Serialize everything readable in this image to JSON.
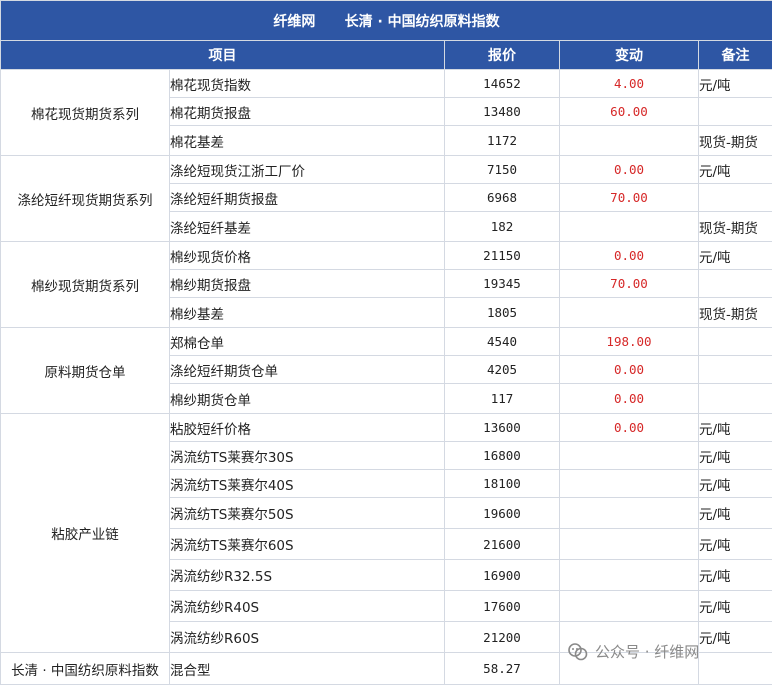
{
  "title": {
    "source": "纤维网",
    "index_name": "长清 · 中国纺织原料指数"
  },
  "columns": {
    "item": "项目",
    "price": "报价",
    "change": "变动",
    "note": "备注"
  },
  "groups": [
    {
      "name": "棉花现货期货系列",
      "rows": [
        {
          "item": "棉花现货指数",
          "price": "14652",
          "change": "4.00",
          "note": "元/吨"
        },
        {
          "item": "棉花期货报盘",
          "price": "13480",
          "change": "60.00",
          "note": ""
        },
        {
          "item": "棉花基差",
          "price": "1172",
          "change": "",
          "note": "现货-期货"
        }
      ]
    },
    {
      "name": "涤纶短纤现货期货系列",
      "rows": [
        {
          "item": "涤纶短现货江浙工厂价",
          "price": "7150",
          "change": "0.00",
          "note": "元/吨"
        },
        {
          "item": "涤纶短纤期货报盘",
          "price": "6968",
          "change": "70.00",
          "note": ""
        },
        {
          "item": "涤纶短纤基差",
          "price": "182",
          "change": "",
          "note": "现货-期货"
        }
      ]
    },
    {
      "name": "棉纱现货期货系列",
      "rows": [
        {
          "item": "棉纱现货价格",
          "price": "21150",
          "change": "0.00",
          "note": "元/吨"
        },
        {
          "item": "棉纱期货报盘",
          "price": "19345",
          "change": "70.00",
          "note": ""
        },
        {
          "item": "棉纱基差",
          "price": "1805",
          "change": "",
          "note": "现货-期货"
        }
      ]
    },
    {
      "name": "原料期货仓单",
      "rows": [
        {
          "item": "郑棉仓单",
          "price": "4540",
          "change": "198.00",
          "note": ""
        },
        {
          "item": "涤纶短纤期货仓单",
          "price": "4205",
          "change": "0.00",
          "note": ""
        },
        {
          "item": "棉纱期货仓单",
          "price": "117",
          "change": "0.00",
          "note": ""
        }
      ]
    },
    {
      "name": "粘胶产业链",
      "rows": [
        {
          "item": "粘胶短纤价格",
          "price": "13600",
          "change": "0.00",
          "note": "元/吨"
        },
        {
          "item": "涡流纺TS莱赛尔30S",
          "price": "16800",
          "change": "",
          "note": "元/吨"
        },
        {
          "item": "涡流纺TS莱赛尔40S",
          "price": "18100",
          "change": "",
          "note": "元/吨"
        },
        {
          "item": "涡流纺TS莱赛尔50S",
          "price": "19600",
          "change": "",
          "note": "元/吨"
        },
        {
          "item": "涡流纺TS莱赛尔60S",
          "price": "21600",
          "change": "",
          "note": "元/吨"
        },
        {
          "item": "涡流纺纱R32.5S",
          "price": "16900",
          "change": "",
          "note": "元/吨"
        },
        {
          "item": "涡流纺纱R40S",
          "price": "17600",
          "change": "",
          "note": "元/吨"
        },
        {
          "item": "涡流纺纱R60S",
          "price": "21200",
          "change": "",
          "note": "元/吨"
        }
      ]
    }
  ],
  "summary": {
    "label": "长清 · 中国纺织原料指数",
    "type": "混合型",
    "value": "58.27"
  },
  "watermark": {
    "text": "公众号 · 纤维网",
    "icon": "wechat-official-account-icon"
  },
  "colors": {
    "header_bg": "#2e56a4",
    "header_text": "#ffffff",
    "change_text": "#d62828",
    "border": "#d4d9e2"
  }
}
